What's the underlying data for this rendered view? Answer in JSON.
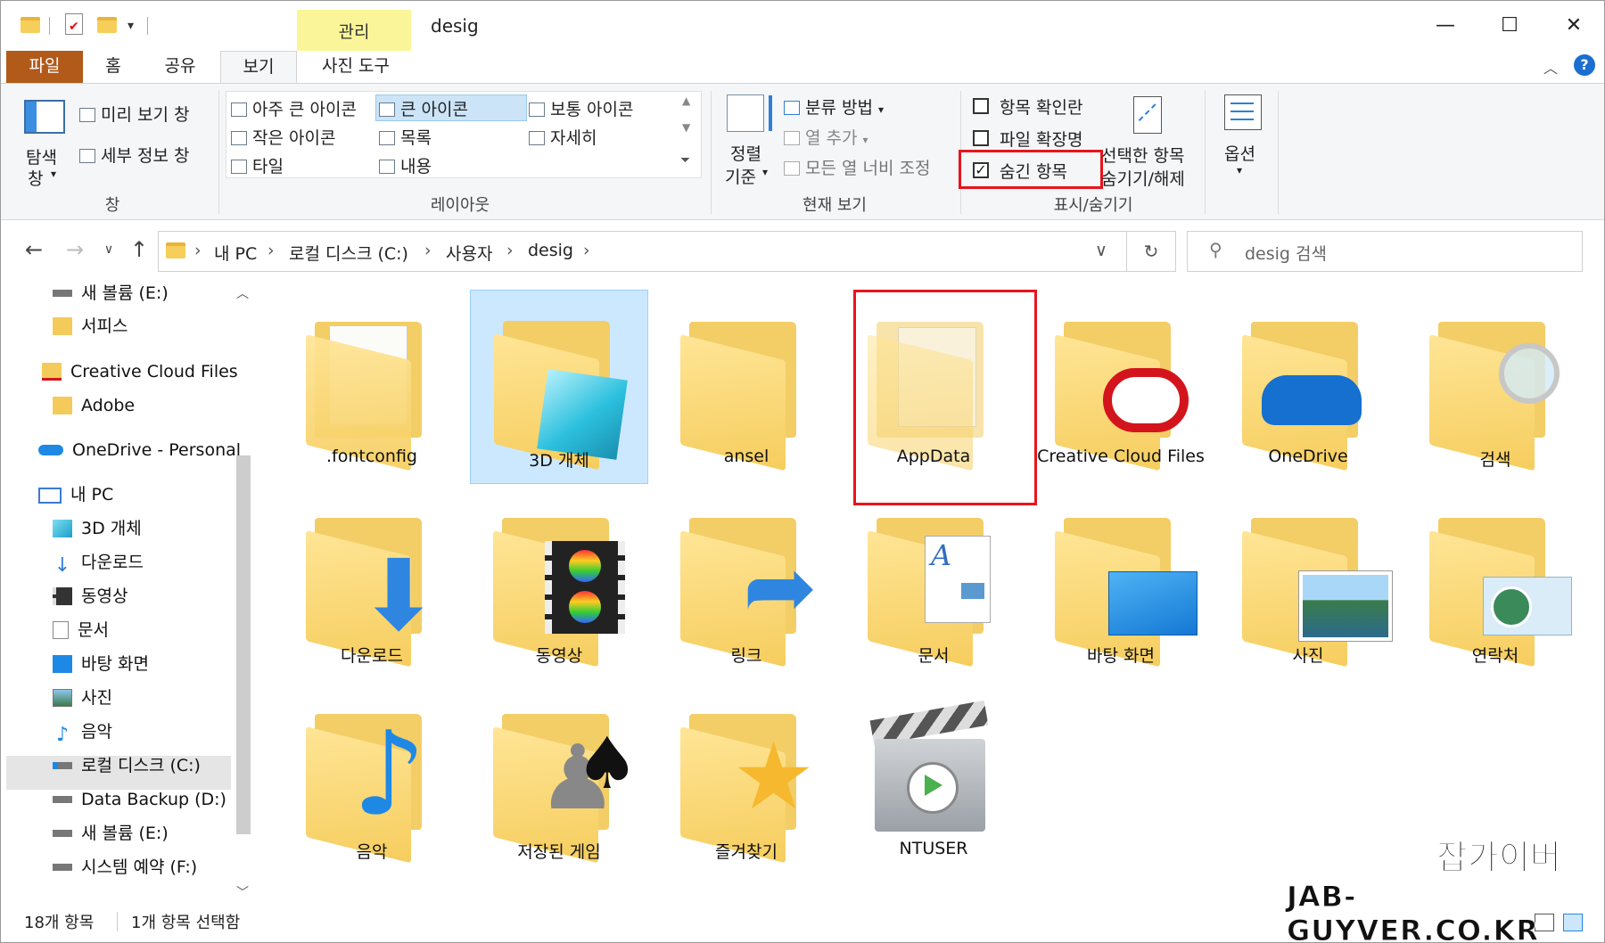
{
  "window": {
    "title": "desig",
    "context_tab": "관리",
    "minimize": "—",
    "maximize": "☐",
    "close": "✕"
  },
  "ribbon_tabs": [
    "파일",
    "홈",
    "공유",
    "보기",
    "사진 도구"
  ],
  "ribbon": {
    "pane": {
      "nav_pane_line1": "탐색",
      "nav_pane_line2": "창",
      "preview": "미리 보기 창",
      "details": "세부 정보 창",
      "group": "창"
    },
    "layout": {
      "items": [
        "아주 큰 아이콘",
        "큰 아이콘",
        "보통 아이콘",
        "작은 아이콘",
        "목록",
        "자세히",
        "타일",
        "내용"
      ],
      "group": "레이아웃"
    },
    "current_view": {
      "sort_line1": "정렬",
      "sort_line2": "기준",
      "group_by": "분류 방법",
      "add_columns": "열 추가",
      "fit_columns": "모든 열 너비 조정",
      "group": "현재 보기"
    },
    "show_hide": {
      "item_checkboxes": "항목 확인란",
      "file_extensions": "파일 확장명",
      "hidden_items": "숨긴 항목",
      "hide_selected_line1": "선택한 항목",
      "hide_selected_line2": "숨기기/해제",
      "group": "표시/숨기기"
    },
    "options": "옵션"
  },
  "address": {
    "crumbs": [
      "내 PC",
      "로컬 디스크 (C:)",
      "사용자",
      "desig"
    ],
    "search_placeholder": "desig 검색"
  },
  "nav_items": [
    "새 볼륨 (E:)",
    "서피스",
    "Creative Cloud Files",
    "Adobe",
    "OneDrive - Personal",
    "내 PC",
    "3D 개체",
    "다운로드",
    "동영상",
    "문서",
    "바탕 화면",
    "사진",
    "음악",
    "로컬 디스크 (C:)",
    "Data Backup (D:)",
    "새 볼륨 (E:)",
    "시스템 예약 (F:)"
  ],
  "files": [
    ".fontconfig",
    "3D 개체",
    "ansel",
    "AppData",
    "Creative Cloud Files",
    "OneDrive",
    "검색",
    "다운로드",
    "동영상",
    "링크",
    "문서",
    "바탕 화면",
    "사진",
    "연락처",
    "음악",
    "저장된 게임",
    "즐겨찾기",
    "NTUSER"
  ],
  "status": {
    "count": "18개 항목",
    "selected": "1개 항목 선택함"
  },
  "watermark": {
    "line1": "잡가이버",
    "line2": "JAB-GUYVER.CO.KR"
  }
}
